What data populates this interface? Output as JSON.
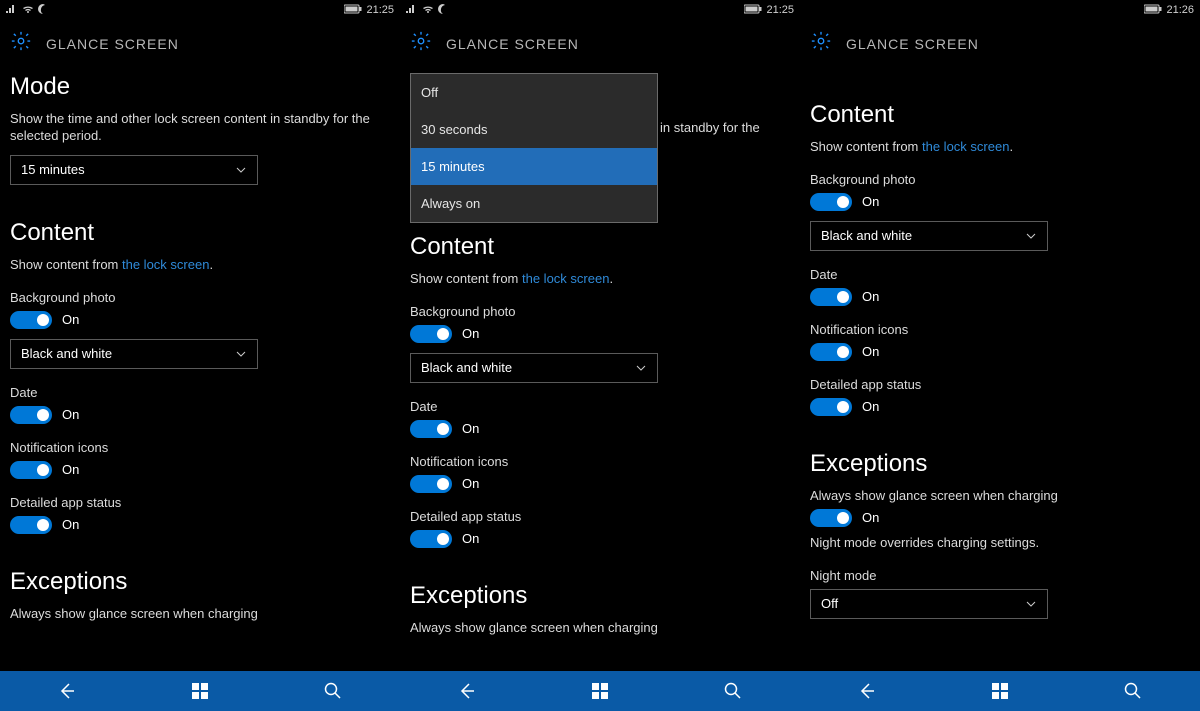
{
  "status": {
    "time1": "21:25",
    "time3": "21:26"
  },
  "header": {
    "title": "GLANCE SCREEN"
  },
  "sections": {
    "mode_title": "Mode",
    "mode_desc": "Show the time and other lock screen content in standby for the selected period.",
    "mode_value": "15 minutes",
    "mode_options": [
      "Off",
      "30 seconds",
      "15 minutes",
      "Always on"
    ],
    "content_title": "Content",
    "content_desc_pre": "Show content from ",
    "content_desc_link": "the lock screen",
    "content_desc_post": ".",
    "bgphoto_label": "Background photo",
    "bgphoto_value": "On",
    "photo_mode_value": "Black and white",
    "date_label": "Date",
    "date_value": "On",
    "notif_label": "Notification icons",
    "notif_value": "On",
    "detail_label": "Detailed app status",
    "detail_value": "On",
    "exc_title": "Exceptions",
    "exc_charge_label": "Always show glance screen when charging",
    "exc_charge_value": "On",
    "exc_note": "Night mode overrides charging settings.",
    "night_label": "Night mode",
    "night_value": "Off"
  },
  "screen2_partial_desc": "in standby for the"
}
